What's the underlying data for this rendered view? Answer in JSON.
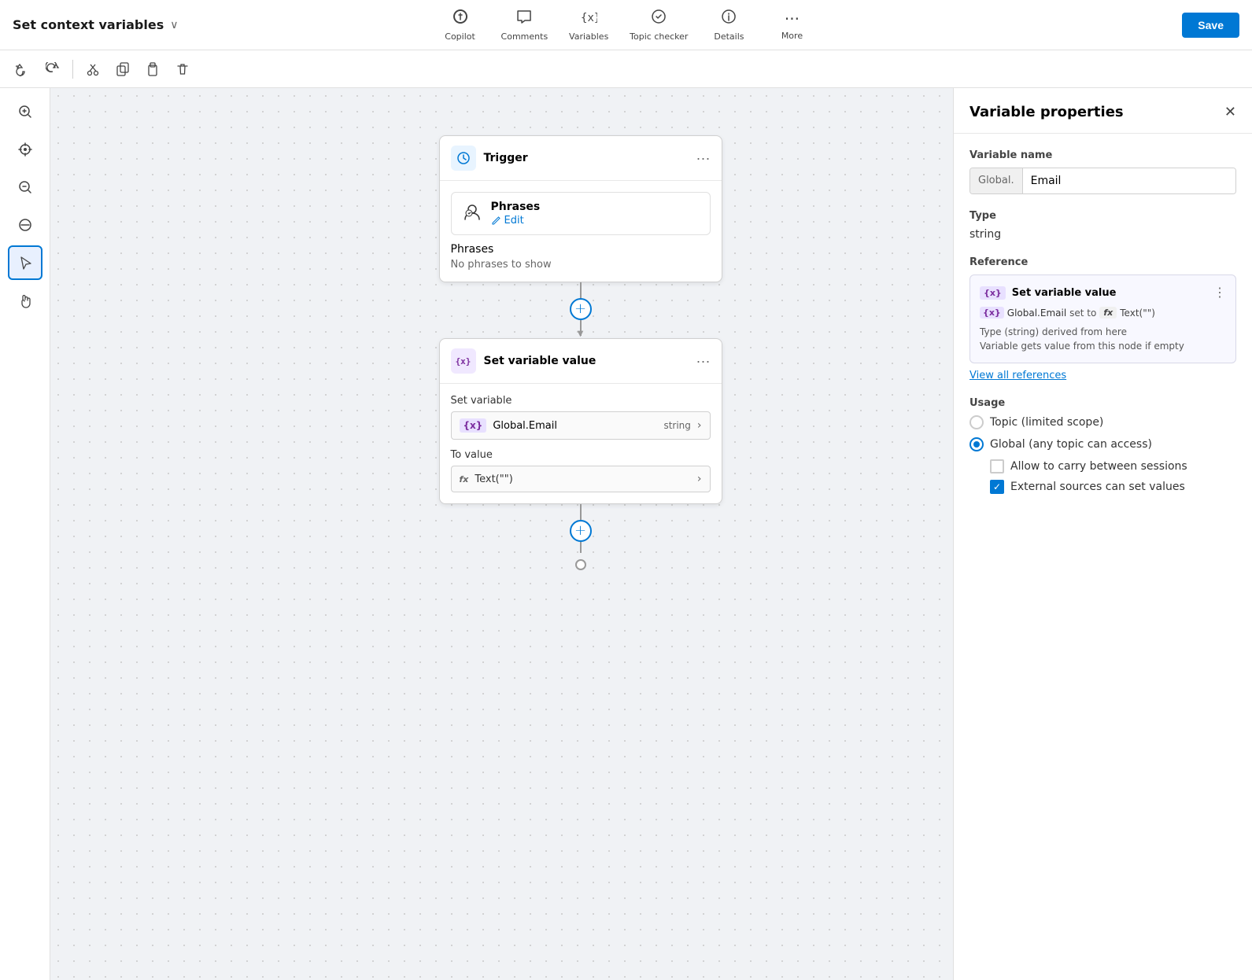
{
  "topbar": {
    "title": "Set context variables",
    "icons": [
      {
        "id": "copilot",
        "icon": "⊕",
        "label": "Copilot"
      },
      {
        "id": "comments",
        "icon": "💬",
        "label": "Comments"
      },
      {
        "id": "variables",
        "icon": "{x}",
        "label": "Variables"
      },
      {
        "id": "topic-checker",
        "icon": "🩺",
        "label": "Topic checker"
      },
      {
        "id": "details",
        "icon": "ℹ",
        "label": "Details"
      },
      {
        "id": "more",
        "icon": "···",
        "label": "More"
      }
    ],
    "save_label": "Save"
  },
  "toolbar": {
    "undo_label": "↩",
    "redo_label": "↪",
    "cut_label": "✂",
    "copy_label": "⧉",
    "paste_label": "📋",
    "delete_label": "🗑"
  },
  "canvas": {
    "trigger_node": {
      "title": "Trigger",
      "icon": "💡",
      "menu": "···",
      "phrases_title": "Phrases",
      "phrases_edit": "Edit",
      "phrases_empty_label": "Phrases",
      "phrases_empty_text": "No phrases to show"
    },
    "set_variable_node": {
      "title": "Set variable value",
      "icon": "{x}",
      "menu": "···",
      "set_variable_label": "Set variable",
      "var_icon": "{x}",
      "var_name": "Global.Email",
      "var_type": "string",
      "to_value_label": "To value",
      "fx_icon": "fx",
      "fx_value": "Text(\"\")"
    }
  },
  "right_panel": {
    "title": "Variable properties",
    "var_name_section": "Variable name",
    "var_prefix": "Global.",
    "var_name_value": "Email",
    "type_section": "Type",
    "type_value": "string",
    "reference_section": "Reference",
    "ref_title": "Set variable value",
    "ref_var": "{x}",
    "ref_var_name": "Global.Email",
    "ref_set_to": "set to",
    "ref_fx": "fx",
    "ref_text": "Text(\"\")",
    "ref_note_line1": "Type (string) derived from here",
    "ref_note_line2": "Variable gets value from this node if empty",
    "view_all_label": "View all references",
    "usage_section": "Usage",
    "usage_option1": "Topic (limited scope)",
    "usage_option2": "Global (any topic can access)",
    "checkbox1": "Allow to carry between sessions",
    "checkbox2": "External sources can set values"
  },
  "left_tools": [
    {
      "id": "zoom-in",
      "icon": "🔍+"
    },
    {
      "id": "center",
      "icon": "⊙"
    },
    {
      "id": "zoom-out",
      "icon": "🔍-"
    },
    {
      "id": "no-entry",
      "icon": "🚫"
    },
    {
      "id": "cursor",
      "icon": "↖"
    },
    {
      "id": "hand",
      "icon": "✋"
    }
  ]
}
